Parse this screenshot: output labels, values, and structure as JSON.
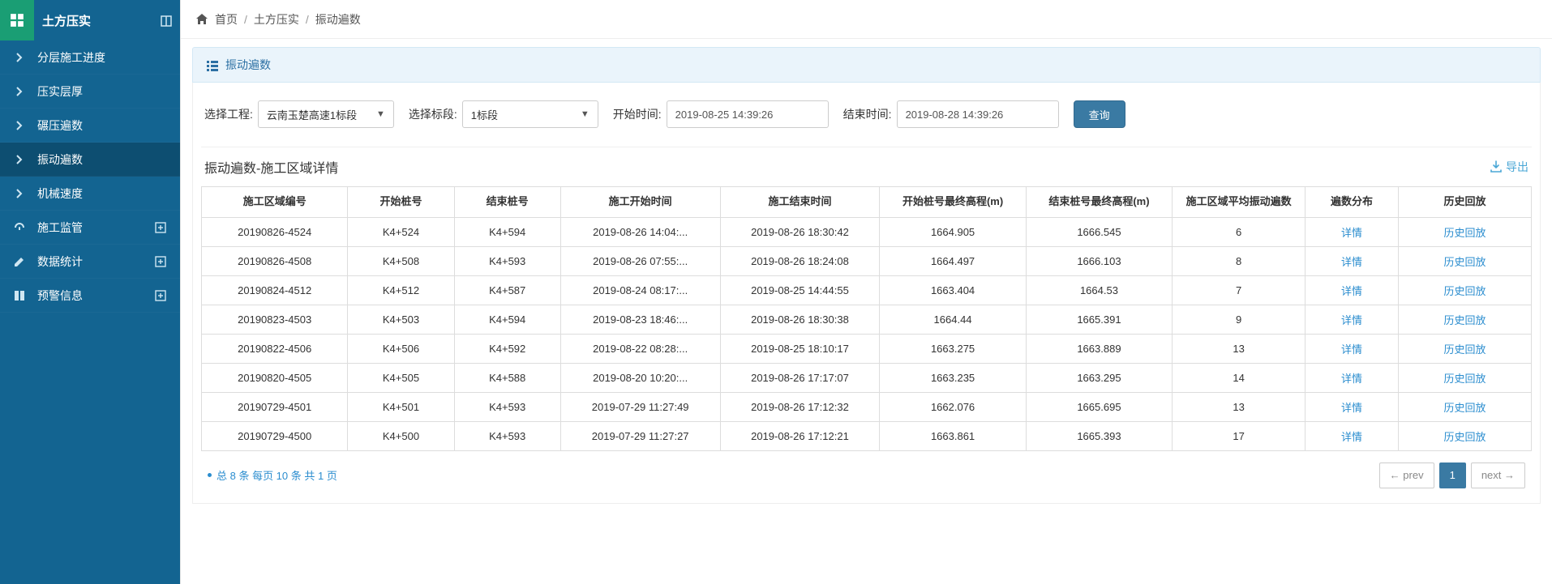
{
  "sidebar": {
    "title": "土方压实",
    "items": [
      {
        "label": "分层施工进度",
        "type": "sub"
      },
      {
        "label": "压实层厚",
        "type": "sub"
      },
      {
        "label": "碾压遍数",
        "type": "sub"
      },
      {
        "label": "振动遍数",
        "type": "sub",
        "active": true
      },
      {
        "label": "机械速度",
        "type": "sub"
      },
      {
        "label": "施工监管",
        "type": "sect",
        "icon": "dashboard"
      },
      {
        "label": "数据统计",
        "type": "sect",
        "icon": "edit"
      },
      {
        "label": "预警信息",
        "type": "sect",
        "icon": "columns"
      }
    ]
  },
  "breadcrumb": {
    "home": "首页",
    "level1": "土方压实",
    "level2": "振动遍数"
  },
  "panel": {
    "title": "振动遍数"
  },
  "filters": {
    "project_label": "选择工程:",
    "project_value": "云南玉楚高速1标段",
    "section_label": "选择标段:",
    "section_value": "1标段",
    "start_label": "开始时间:",
    "start_value": "2019-08-25 14:39:26",
    "end_label": "结束时间:",
    "end_value": "2019-08-28 14:39:26",
    "query_btn": "查询"
  },
  "section": {
    "title": "振动遍数-施工区域详情",
    "export": "导出"
  },
  "table": {
    "headers": [
      "施工区域编号",
      "开始桩号",
      "结束桩号",
      "施工开始时间",
      "施工结束时间",
      "开始桩号最终高程(m)",
      "结束桩号最终高程(m)",
      "施工区域平均振动遍数",
      "遍数分布",
      "历史回放"
    ],
    "detail_link": "详情",
    "history_link": "历史回放",
    "rows": [
      {
        "id": "20190826-4524",
        "start_pile": "K4+524",
        "end_pile": "K4+594",
        "start_time": "2019-08-26 14:04:...",
        "end_time": "2019-08-26 18:30:42",
        "start_elev": "1664.905",
        "end_elev": "1666.545",
        "avg": "6"
      },
      {
        "id": "20190826-4508",
        "start_pile": "K4+508",
        "end_pile": "K4+593",
        "start_time": "2019-08-26 07:55:...",
        "end_time": "2019-08-26 18:24:08",
        "start_elev": "1664.497",
        "end_elev": "1666.103",
        "avg": "8"
      },
      {
        "id": "20190824-4512",
        "start_pile": "K4+512",
        "end_pile": "K4+587",
        "start_time": "2019-08-24 08:17:...",
        "end_time": "2019-08-25 14:44:55",
        "start_elev": "1663.404",
        "end_elev": "1664.53",
        "avg": "7"
      },
      {
        "id": "20190823-4503",
        "start_pile": "K4+503",
        "end_pile": "K4+594",
        "start_time": "2019-08-23 18:46:...",
        "end_time": "2019-08-26 18:30:38",
        "start_elev": "1664.44",
        "end_elev": "1665.391",
        "avg": "9"
      },
      {
        "id": "20190822-4506",
        "start_pile": "K4+506",
        "end_pile": "K4+592",
        "start_time": "2019-08-22 08:28:...",
        "end_time": "2019-08-25 18:10:17",
        "start_elev": "1663.275",
        "end_elev": "1663.889",
        "avg": "13"
      },
      {
        "id": "20190820-4505",
        "start_pile": "K4+505",
        "end_pile": "K4+588",
        "start_time": "2019-08-20 10:20:...",
        "end_time": "2019-08-26 17:17:07",
        "start_elev": "1663.235",
        "end_elev": "1663.295",
        "avg": "14"
      },
      {
        "id": "20190729-4501",
        "start_pile": "K4+501",
        "end_pile": "K4+593",
        "start_time": "2019-07-29 11:27:49",
        "end_time": "2019-08-26 17:12:32",
        "start_elev": "1662.076",
        "end_elev": "1665.695",
        "avg": "13"
      },
      {
        "id": "20190729-4500",
        "start_pile": "K4+500",
        "end_pile": "K4+593",
        "start_time": "2019-07-29 11:27:27",
        "end_time": "2019-08-26 17:12:21",
        "start_elev": "1663.861",
        "end_elev": "1665.393",
        "avg": "17"
      }
    ]
  },
  "footer": {
    "info": "总 8 条  每页 10 条  共 1 页",
    "prev": "← prev",
    "page": "1",
    "next": "next →"
  }
}
